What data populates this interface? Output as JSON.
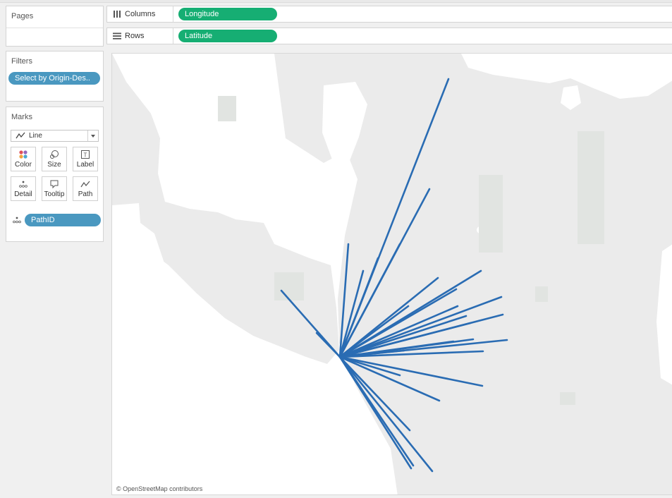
{
  "pages": {
    "title": "Pages"
  },
  "filters": {
    "title": "Filters",
    "pill": "Select by Origin-Des.."
  },
  "marks": {
    "title": "Marks",
    "mark_type": "Line",
    "buttons": [
      {
        "label": "Color",
        "icon": "color-icon"
      },
      {
        "label": "Size",
        "icon": "size-icon"
      },
      {
        "label": "Label",
        "icon": "label-icon"
      },
      {
        "label": "Detail",
        "icon": "detail-icon"
      },
      {
        "label": "Tooltip",
        "icon": "tooltip-icon"
      },
      {
        "label": "Path",
        "icon": "path-icon"
      }
    ],
    "path_field": "PathID"
  },
  "shelves": {
    "columns": {
      "label": "Columns",
      "pill": "Longitude"
    },
    "rows": {
      "label": "Rows",
      "pill": "Latitude"
    }
  },
  "map": {
    "attribution": "© OpenStreetMap contributors"
  },
  "colors": {
    "line": "#2a6cb3",
    "pill_blue": "#4a98c0",
    "pill_green": "#16ae73",
    "land": "#ebebeb",
    "water": "#ffffff"
  }
}
